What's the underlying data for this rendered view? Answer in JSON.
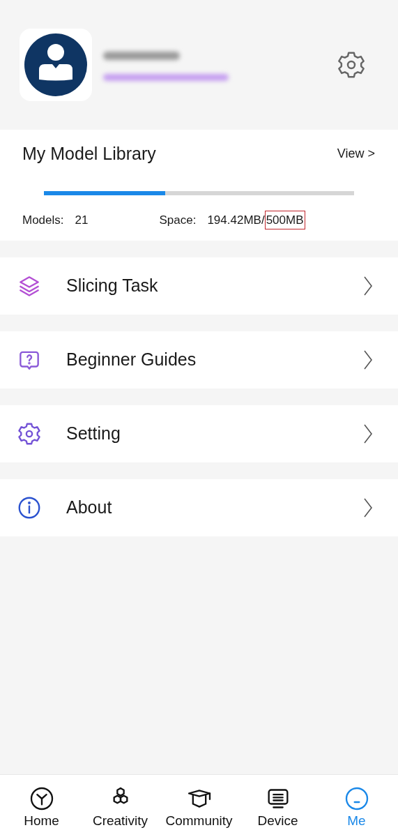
{
  "library": {
    "title": "My Model Library",
    "view_link": "View >",
    "level": 0.39,
    "models_label": "Models:",
    "models_value": "21",
    "space_label": "Space:",
    "space_used": "194.42MB/",
    "space_total": "500MB"
  },
  "menu": [
    {
      "kind": "layers",
      "label": "Slicing Task",
      "color": "#b34fd4"
    },
    {
      "kind": "help",
      "label": "Beginner Guides",
      "color": "#8b5ad8"
    },
    {
      "kind": "gear",
      "label": "Setting",
      "color": "#7352d6"
    },
    {
      "kind": "info",
      "label": "About",
      "color": "#2b52cf"
    }
  ],
  "nav": [
    {
      "kind": "home",
      "label": "Home",
      "selected": false
    },
    {
      "kind": "creativity",
      "label": "Creativity",
      "selected": false
    },
    {
      "kind": "community",
      "label": "Community",
      "selected": false
    },
    {
      "kind": "device",
      "label": "Device",
      "selected": false
    },
    {
      "kind": "me",
      "label": "Me",
      "selected": true
    }
  ]
}
